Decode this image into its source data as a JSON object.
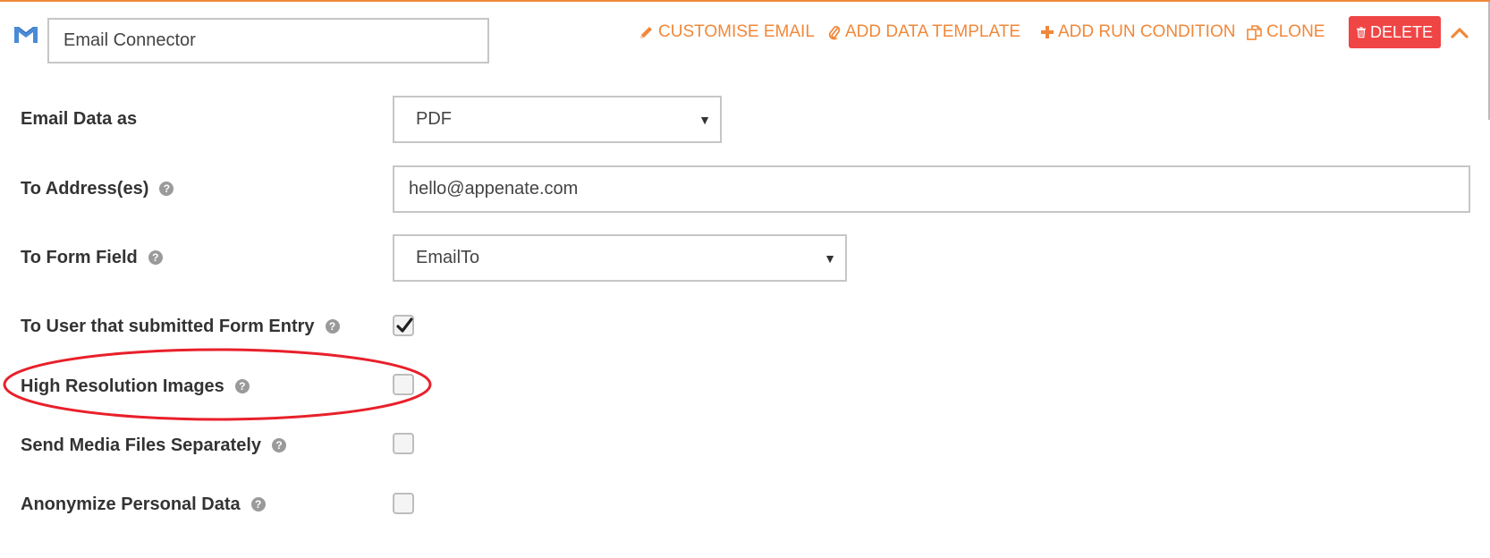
{
  "header": {
    "connector_name": "Email Connector",
    "actions": {
      "customise_email": "CUSTOMISE EMAIL",
      "add_data_template": "ADD DATA TEMPLATE",
      "add_run_condition": "ADD RUN CONDITION",
      "clone": "CLONE",
      "delete": "DELETE"
    }
  },
  "form": {
    "email_data_as": {
      "label": "Email Data as",
      "value": "PDF"
    },
    "to_addresses": {
      "label": "To Address(es)",
      "value": "hello@appenate.com"
    },
    "to_form_field": {
      "label": "To Form Field",
      "value": "EmailTo"
    },
    "to_user_submitted": {
      "label": "To User that submitted Form Entry",
      "checked": true
    },
    "high_resolution_images": {
      "label": "High Resolution Images",
      "checked": false
    },
    "send_media_separately": {
      "label": "Send Media Files Separately",
      "checked": false
    },
    "anonymize_personal_data": {
      "label": "Anonymize Personal Data",
      "checked": false
    }
  },
  "help_glyph": "?",
  "colors": {
    "accent": "#f0883a",
    "delete": "#f04545",
    "highlight_ellipse": "#e8202a"
  }
}
